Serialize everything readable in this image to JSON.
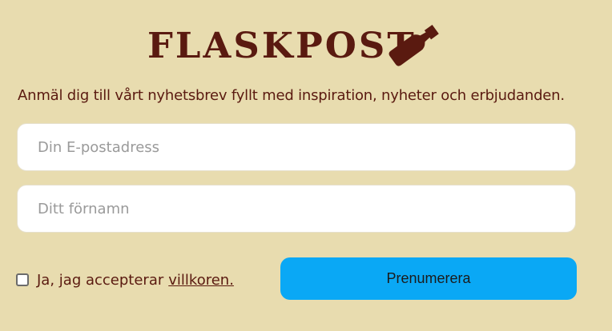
{
  "header": {
    "title": "FLASKPOST",
    "bottle_icon": "bottle-icon"
  },
  "tagline": "Anmäl dig till vårt nyhetsbrev fyllt med inspiration, nyheter och erbjudanden.",
  "form": {
    "email_placeholder": "Din E-postadress",
    "email_value": "",
    "name_placeholder": "Ditt förnamn",
    "name_value": "",
    "terms_text": "Ja, jag accepterar",
    "terms_link": "villkoren.",
    "terms_checked": false,
    "submit_label": "Prenumerera"
  },
  "colors": {
    "background": "#e8dcaf",
    "text": "#5a1a10",
    "button": "#0aa8f5",
    "bottle": "#5a1a10"
  }
}
